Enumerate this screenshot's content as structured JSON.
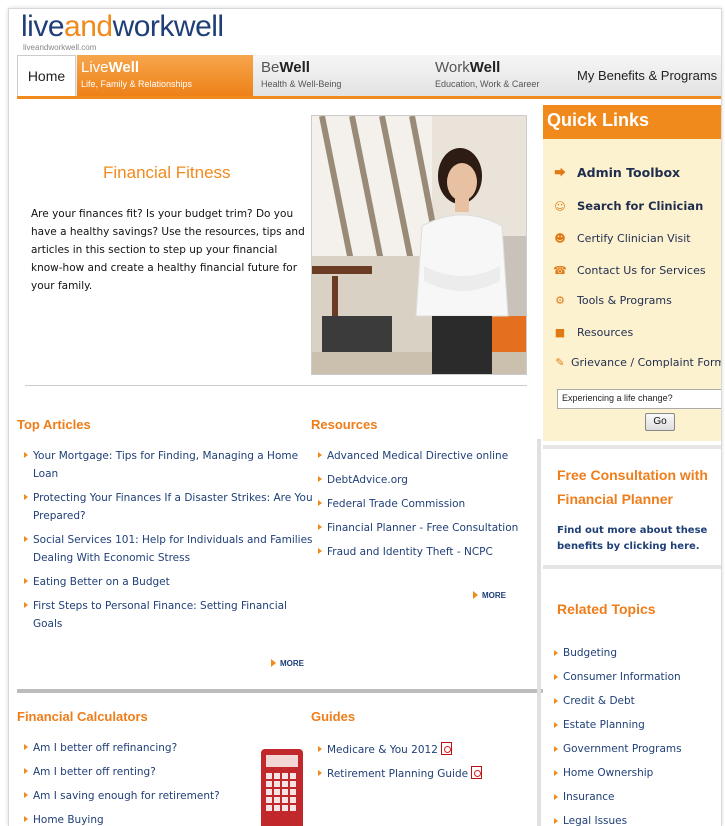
{
  "brand": {
    "part1": "live",
    "part2": "and",
    "part3": "workwell",
    "url": "liveandworkwell.com"
  },
  "nav": {
    "home": "Home",
    "live_light": "Live",
    "live_bold": "Well",
    "live_sub": "Life, Family & Relationships",
    "be_light": "Be",
    "be_bold": "Well",
    "be_sub": "Health & Well-Being",
    "work_light": "Work",
    "work_bold": "Well",
    "work_sub": "Education, Work & Career",
    "benefits": "My Benefits & Programs"
  },
  "hero": {
    "title": "Financial Fitness",
    "text": "Are your finances fit? Is your budget trim? Do you have a healthy savings? Use the resources, tips and articles in this section to step up your financial know-how and create a healthy financial future for your family."
  },
  "top_articles": {
    "title": "Top Articles",
    "items": [
      "Your Mortgage: Tips for Finding, Managing a Home Loan",
      "Protecting Your Finances If a Disaster Strikes: Are You Prepared?",
      "Social Services 101: Help for Individuals and Families Dealing With Economic Stress",
      "Eating Better on a Budget",
      "First Steps to Personal Finance: Setting Financial Goals"
    ],
    "more": "MORE"
  },
  "resources": {
    "title": "Resources",
    "items": [
      "Advanced Medical Directive online",
      "DebtAdvice.org",
      "Federal Trade Commission",
      "Financial Planner - Free Consultation",
      "Fraud and Identity Theft - NCPC"
    ],
    "more": "MORE"
  },
  "calculators": {
    "title": "Financial Calculators",
    "items": [
      "Am I better off refinancing?",
      "Am I better off renting?",
      "Am I saving enough for retirement?",
      "Home Buying"
    ]
  },
  "guides": {
    "title": "Guides",
    "items": [
      "Medicare & You 2012",
      "Retirement Planning Guide"
    ]
  },
  "quick_links": {
    "title": "Quick Links",
    "items": [
      {
        "label": "Admin Toolbox",
        "icon": "key-icon"
      },
      {
        "label": "Search for Clinician",
        "icon": "people-icon"
      },
      {
        "label": "Certify Clinician Visit",
        "icon": "person-check-icon"
      },
      {
        "label": "Contact Us for Services",
        "icon": "contact-icon"
      },
      {
        "label": "Tools & Programs",
        "icon": "gears-icon"
      },
      {
        "label": "Resources",
        "icon": "folder-icon"
      },
      {
        "label": "Grievance / Complaint Form",
        "icon": "pen-icon"
      }
    ],
    "input_value": "Experiencing a life change?",
    "go": "Go"
  },
  "free_consult": {
    "title": "Free Consultation with Financial Planner",
    "text": "Find out more about these benefits by clicking here."
  },
  "related_topics": {
    "title": "Related Topics",
    "items": [
      "Budgeting",
      "Consumer Information",
      "Credit & Debt",
      "Estate Planning",
      "Government Programs",
      "Home Ownership",
      "Insurance",
      "Legal Issues"
    ]
  },
  "colors": {
    "accent": "#f08a1c",
    "link": "#1f3f77",
    "quick_links_bg": "#fdf2cf"
  }
}
